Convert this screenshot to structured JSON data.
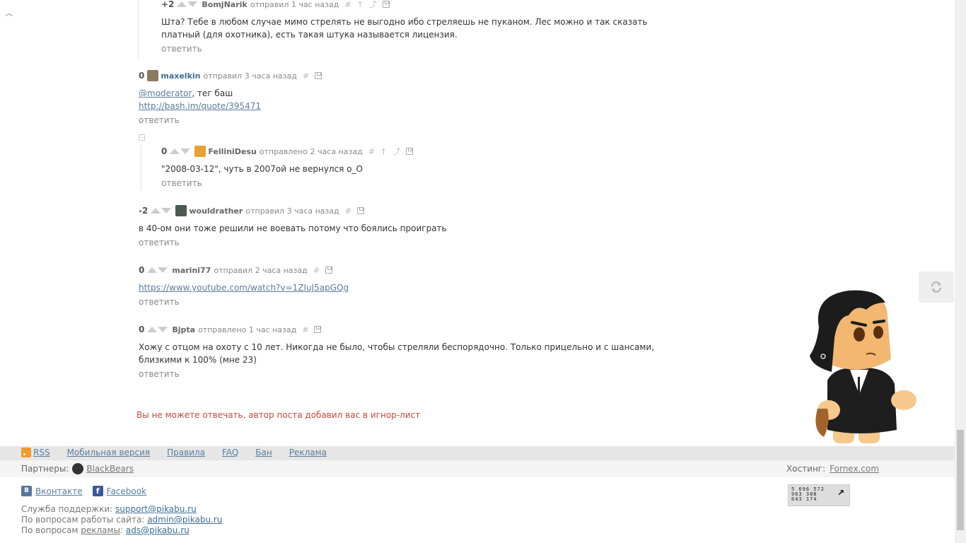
{
  "comments": [
    {
      "rating": "+2",
      "author": "BomjNarik",
      "sent": "отправил 1 час назад",
      "text": "Шта? Тебе в любом случае мимо стрелять не выгодно ибо стреляешь не пуканом. Лес можно и так сказать платный (для охотника), есть такая штука называется лицензия.",
      "reply": "ответить"
    },
    {
      "rating": "0",
      "author": "maxelkin",
      "sent": "отправил 3 часа назад",
      "mention": "@moderator",
      "text_after_mention": ", тег баш",
      "link": "http://bash.im/quote/395471",
      "reply": "ответить"
    },
    {
      "rating": "0",
      "author": "FelliniDesu",
      "sent": "отправлено 2 часа назад",
      "text": "\"2008-03-12\", чуть в 2007ой не вернулся о_О",
      "reply": "ответить"
    },
    {
      "rating": "-2",
      "author": "wouldrather",
      "sent": "отправил 3 часа назад",
      "text": "в 40-ом они тоже решили не воевать потому что боялись проиграть",
      "reply": "ответить"
    },
    {
      "rating": "0",
      "author": "marini77",
      "sent": "отправил 2 часа назад",
      "link": "https://www.youtube.com/watch?v=1ZIuJ5apGQg",
      "reply": "ответить"
    },
    {
      "rating": "0",
      "author": "Bjpta",
      "sent": "отправлено 1 час назад",
      "text": "Хожу с отцом на охоту с 10 лет. Никогда не было, чтобы стреляли беспорядочно. Только прицельно и с шансами, близкими к 100% (мне 23)",
      "reply": "ответить"
    }
  ],
  "ignore_message": "Вы не можете отвечать, автор поста добавил вас в игнор-лист",
  "footer": {
    "links": [
      "RSS",
      "Мобильная версия",
      "Правила",
      "FAQ",
      "Бан",
      "Реклама"
    ],
    "partners_label": "Партнеры:",
    "partner": "BlackBears",
    "hosting_label": "Хостинг:",
    "hosting": "Fornex.com",
    "vk": "Вконтакте",
    "facebook": "Facebook",
    "support_label": "Служба поддержки:",
    "support_email": "support@pikabu.ru",
    "admin_label": "По вопросам работы сайта:",
    "admin_email": "admin@pikabu.ru",
    "ads_label_prefix": "По вопросам ",
    "ads_label_link": "рекламы",
    "ads_label_suffix": ":",
    "ads_email": "ads@pikabu.ru",
    "counter_lines": [
      "5 696 572",
      "963 308",
      "643 174"
    ]
  },
  "icons": {
    "hash": "#",
    "up_arrow": "↑",
    "parent": "⤴"
  },
  "colors": {
    "link": "#5a7ca0",
    "author": "#3c6d95",
    "warning": "#c8493a",
    "vote": "#cccccc"
  }
}
